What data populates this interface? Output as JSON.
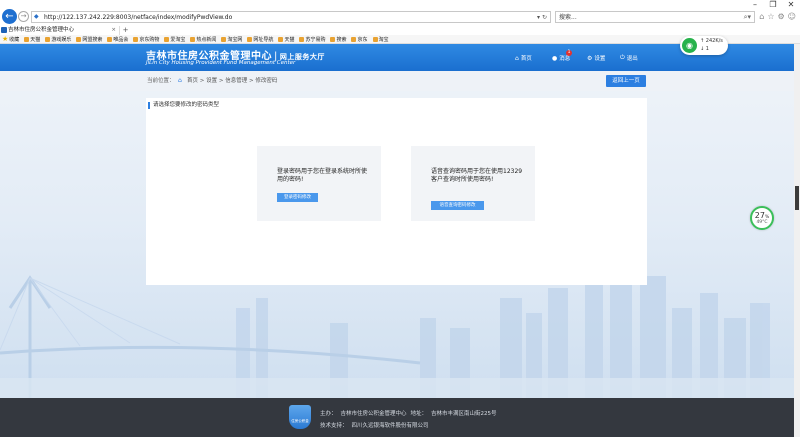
{
  "browser": {
    "url": "http://122.137.242.229:8003/netface/index/modifyPwdView.do",
    "search_placeholder": "搜索...",
    "tab_title": "吉林市住房公积金管理中心",
    "win_min": "–",
    "win_max": "❐",
    "win_close": "✕",
    "favorites": [
      "收藏",
      "天猫",
      "游戏娱乐",
      "网盟搜索",
      "唯品会",
      "京东购物",
      "爱淘宝",
      "热点新闻",
      "淘宝网",
      "网址导航",
      "天猫",
      "苏宁易购",
      "搜索",
      "京东",
      "淘宝"
    ]
  },
  "header": {
    "title_cn": "吉林市住房公积金管理中心",
    "title_sep": "|",
    "subtitle": "网上服务大厅",
    "title_en": "JiLin City Housing Provident Fund Management Center",
    "nav": {
      "home": "首页",
      "message": "消息",
      "message_badge": "1",
      "settings": "设置",
      "logout": "退出"
    }
  },
  "network": {
    "upload": "242K/s",
    "download": "1"
  },
  "breadcrumb": {
    "label": "当前位置：",
    "path": "首页 > 设置 > 信息管理 > 修改密码",
    "back_button": "返回上一页"
  },
  "panel": {
    "title": "请选择您要修改的密码类型",
    "cards": [
      {
        "text": "登录密码用于您在登录系统时所使用的密码!",
        "button": "登录密码修改"
      },
      {
        "text": "语音查询密码用于您在使用12329客户查询时所使用密码!",
        "button": "语音查询密码修改"
      }
    ]
  },
  "gauge": {
    "value": "27",
    "unit": "%",
    "temp": "49°C"
  },
  "footer": {
    "logo_text": "住房公积金",
    "host_label": "主办：",
    "host": "吉林市住房公积金管理中心",
    "address_label": "地址：",
    "address": "吉林市丰满区南山街225号",
    "support_label": "技术支持：",
    "support": "四川久远银海软件股份有限公司"
  }
}
